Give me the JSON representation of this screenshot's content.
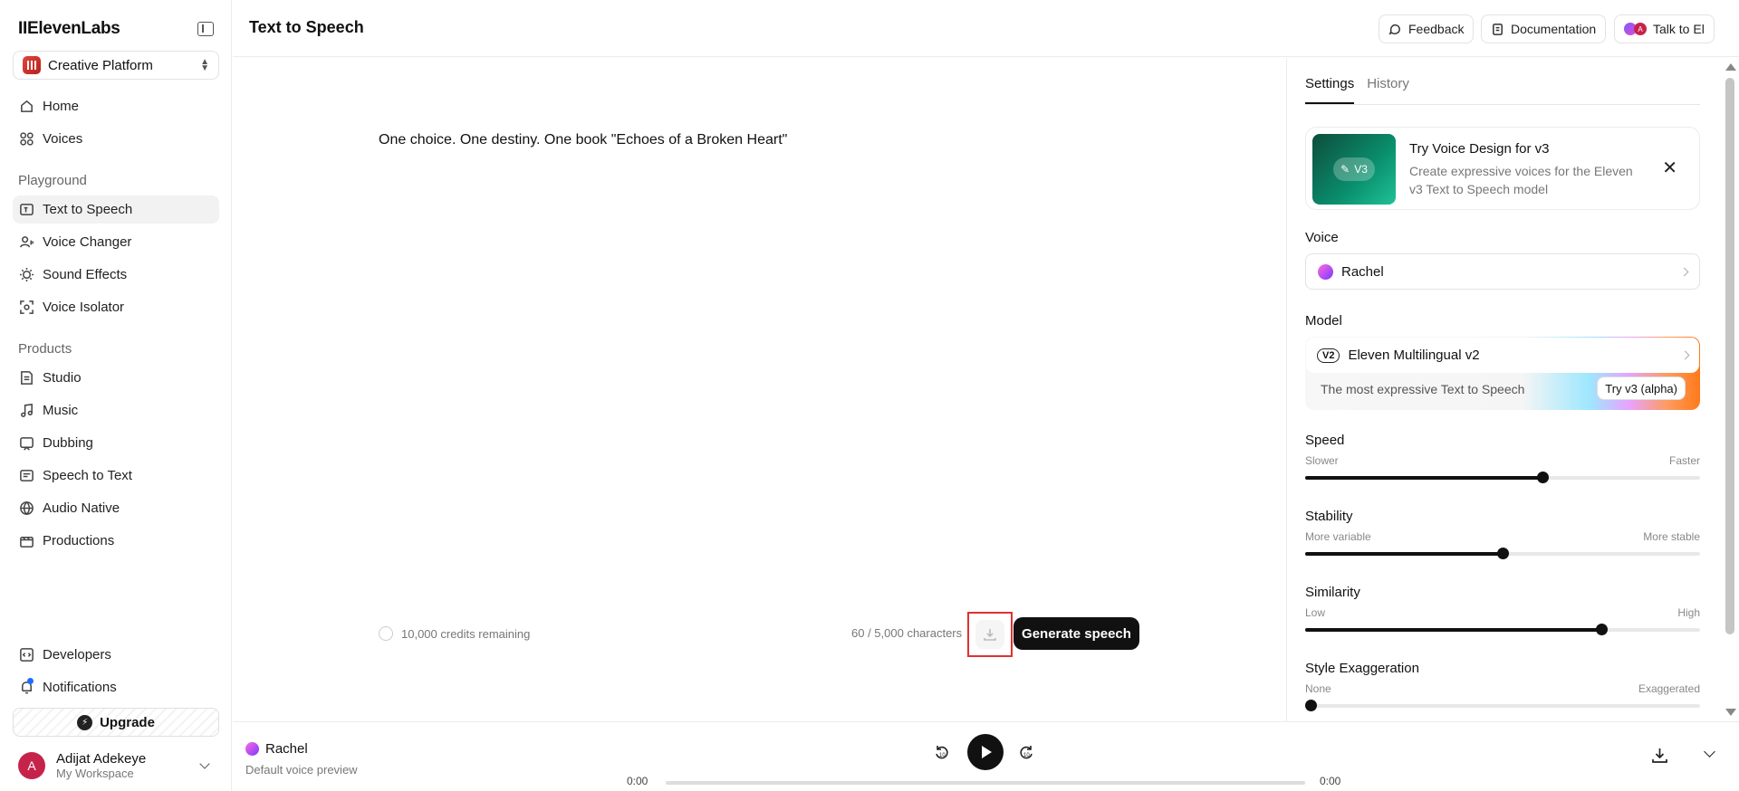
{
  "sidebar": {
    "logo": "IIElevenLabs",
    "platform": "Creative Platform",
    "nav_top": [
      {
        "label": "Home",
        "icon": "home-icon"
      },
      {
        "label": "Voices",
        "icon": "voices-icon"
      }
    ],
    "playground_label": "Playground",
    "playground": [
      {
        "label": "Text to Speech",
        "icon": "text-to-speech-icon",
        "active": true
      },
      {
        "label": "Voice Changer",
        "icon": "voice-changer-icon"
      },
      {
        "label": "Sound Effects",
        "icon": "sound-effects-icon"
      },
      {
        "label": "Voice Isolator",
        "icon": "voice-isolator-icon"
      }
    ],
    "products_label": "Products",
    "products": [
      {
        "label": "Studio",
        "icon": "studio-icon"
      },
      {
        "label": "Music",
        "icon": "music-icon"
      },
      {
        "label": "Dubbing",
        "icon": "dubbing-icon"
      },
      {
        "label": "Speech to Text",
        "icon": "speech-to-text-icon"
      },
      {
        "label": "Audio Native",
        "icon": "audio-native-icon"
      },
      {
        "label": "Productions",
        "icon": "productions-icon"
      }
    ],
    "bottom": [
      {
        "label": "Developers",
        "icon": "developers-icon"
      },
      {
        "label": "Notifications",
        "icon": "bell-icon"
      }
    ],
    "upgrade": "Upgrade",
    "user": {
      "initial": "A",
      "name": "Adijat Adekeye",
      "workspace": "My Workspace"
    }
  },
  "header": {
    "title": "Text to Speech",
    "feedback": "Feedback",
    "documentation": "Documentation",
    "talk": "Talk to El",
    "talk_avatar": "A"
  },
  "editor": {
    "text": "One choice. One destiny. One book \"Echoes of a Broken Heart\"",
    "credits": "10,000 credits remaining",
    "char_count": "60 / 5,000 characters",
    "generate": "Generate speech"
  },
  "settings": {
    "tabs": [
      "Settings",
      "History"
    ],
    "promo": {
      "badge": "V3",
      "title": "Try Voice Design for v3",
      "desc": "Create expressive voices for the Eleven v3 Text to Speech model"
    },
    "voice_label": "Voice",
    "voice": "Rachel",
    "model_label": "Model",
    "model_badge": "V2",
    "model": "Eleven Multilingual v2",
    "model_desc": "The most expressive Text to Speech",
    "try_v3": "Try v3 (alpha)",
    "sliders": [
      {
        "title": "Speed",
        "min_label": "Slower",
        "max_label": "Faster",
        "value": 0.6
      },
      {
        "title": "Stability",
        "min_label": "More variable",
        "max_label": "More stable",
        "value": 0.5
      },
      {
        "title": "Similarity",
        "min_label": "Low",
        "max_label": "High",
        "value": 0.75
      },
      {
        "title": "Style Exaggeration",
        "min_label": "None",
        "max_label": "Exaggerated",
        "value": 0.0
      }
    ]
  },
  "player": {
    "voice": "Rachel",
    "subtitle": "Default voice preview",
    "rewind": "10",
    "forward": "10",
    "current_time": "0:00",
    "total_time": "0:00",
    "progress": 0
  }
}
